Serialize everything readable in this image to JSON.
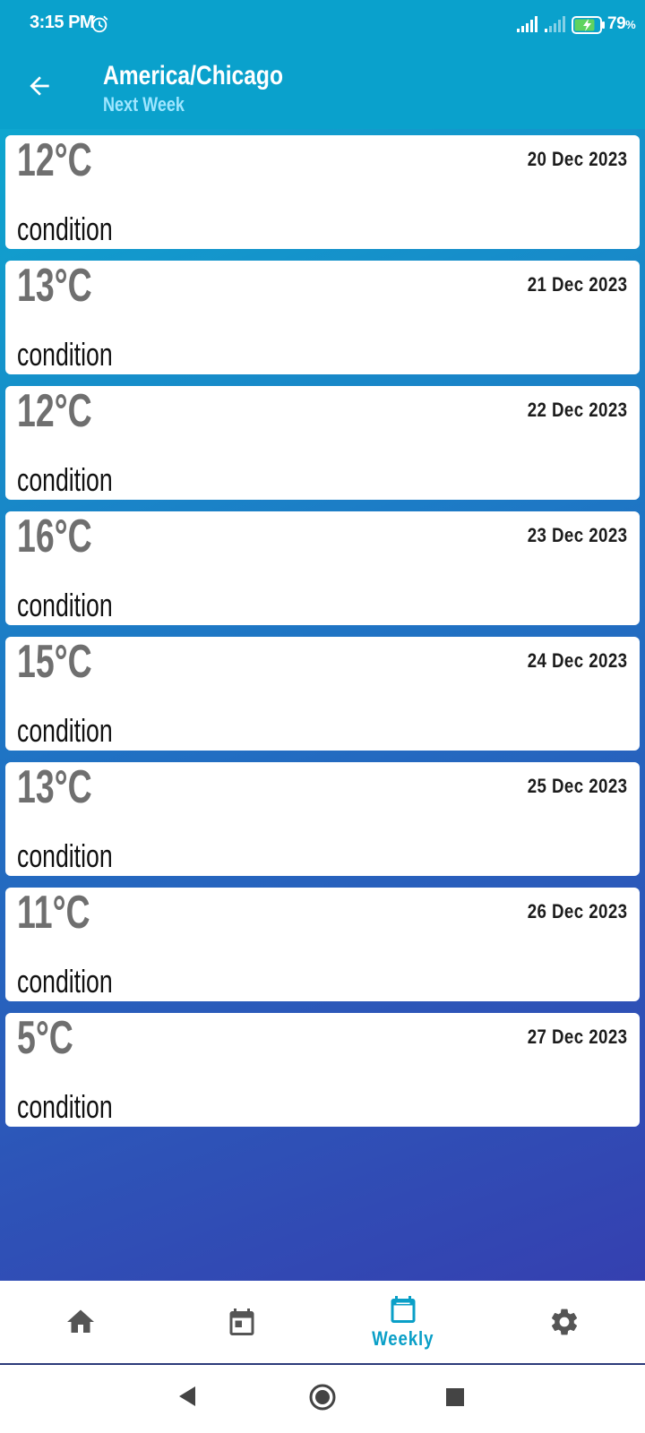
{
  "status_bar": {
    "time": "3:15 PM",
    "battery_percent": "79",
    "battery_unit": "%",
    "icons": [
      "alarm-icon",
      "signal-icon",
      "signal-icon",
      "battery-charging-icon"
    ]
  },
  "app_bar": {
    "title": "America/Chicago",
    "subtitle": "Next Week",
    "back_icon": "arrow-back-icon"
  },
  "forecast": [
    {
      "temp": "12°C",
      "date": "20 Dec 2023",
      "condition": "condition"
    },
    {
      "temp": "13°C",
      "date": "21 Dec 2023",
      "condition": "condition"
    },
    {
      "temp": "12°C",
      "date": "22 Dec 2023",
      "condition": "condition"
    },
    {
      "temp": "16°C",
      "date": "23 Dec 2023",
      "condition": "condition"
    },
    {
      "temp": "15°C",
      "date": "24 Dec 2023",
      "condition": "condition"
    },
    {
      "temp": "13°C",
      "date": "25 Dec 2023",
      "condition": "condition"
    },
    {
      "temp": "11°C",
      "date": "26 Dec 2023",
      "condition": "condition"
    },
    {
      "temp": "5°C",
      "date": "27 Dec 2023",
      "condition": "condition"
    }
  ],
  "bottom_nav": {
    "items": [
      {
        "icon": "home-icon",
        "label": "",
        "active": false
      },
      {
        "icon": "calendar-icon",
        "label": "",
        "active": false
      },
      {
        "icon": "calendar-week-icon",
        "label": "Weekly",
        "active": true
      },
      {
        "icon": "settings-icon",
        "label": "",
        "active": false
      }
    ],
    "active_color": "#0a9fc7",
    "inactive_color": "#555555"
  },
  "colors": {
    "header": "#0aa1cc",
    "gradient_start": "#0ea6cf",
    "gradient_end": "#3540b0"
  }
}
